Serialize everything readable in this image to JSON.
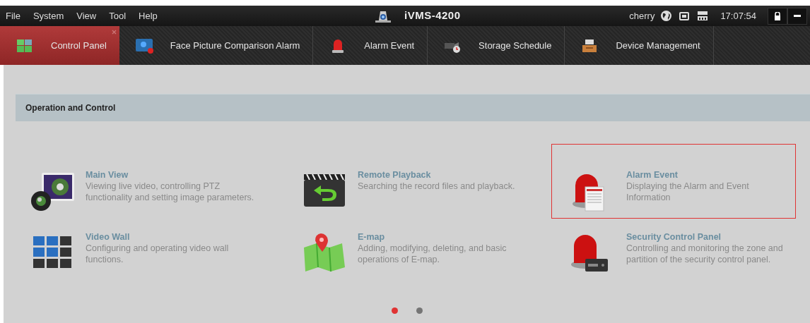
{
  "menu": [
    "File",
    "System",
    "View",
    "Tool",
    "Help"
  ],
  "app_title": "iVMS-4200",
  "user": "cherry",
  "clock": "17:07:54",
  "tabs": [
    {
      "label": "Control Panel",
      "kind": "grid",
      "selected": true
    },
    {
      "label": "Face Picture Comparison Alarm",
      "kind": "face",
      "selected": false
    },
    {
      "label": "Alarm Event",
      "kind": "alarm",
      "selected": false
    },
    {
      "label": "Storage Schedule",
      "kind": "camera",
      "selected": false
    },
    {
      "label": "Device Management",
      "kind": "device",
      "selected": false
    }
  ],
  "section": {
    "title": "Operation and Control"
  },
  "modules": [
    {
      "kind": "main_view",
      "title": "Main View",
      "description": "Viewing live video, controlling PTZ functionality and setting image parameters.",
      "highlighted": false
    },
    {
      "kind": "playback",
      "title": "Remote Playback",
      "description": "Searching the record files and playback.",
      "highlighted": false
    },
    {
      "kind": "alarm_doc",
      "title": "Alarm Event",
      "description": "Displaying the Alarm and Event Information",
      "highlighted": true
    },
    {
      "kind": "video_wall",
      "title": "Video Wall",
      "description": "Configuring and operating video wall functions.",
      "highlighted": false
    },
    {
      "kind": "emap",
      "title": "E-map",
      "description": "Adding, modifying, deleting, and basic operations of E-map.",
      "highlighted": false
    },
    {
      "kind": "security",
      "title": "Security Control Panel",
      "description": "Controlling and monitoring the zone and partition of the security control panel.",
      "highlighted": false
    }
  ],
  "pager": [
    {
      "selected": true
    },
    {
      "selected": false
    }
  ]
}
